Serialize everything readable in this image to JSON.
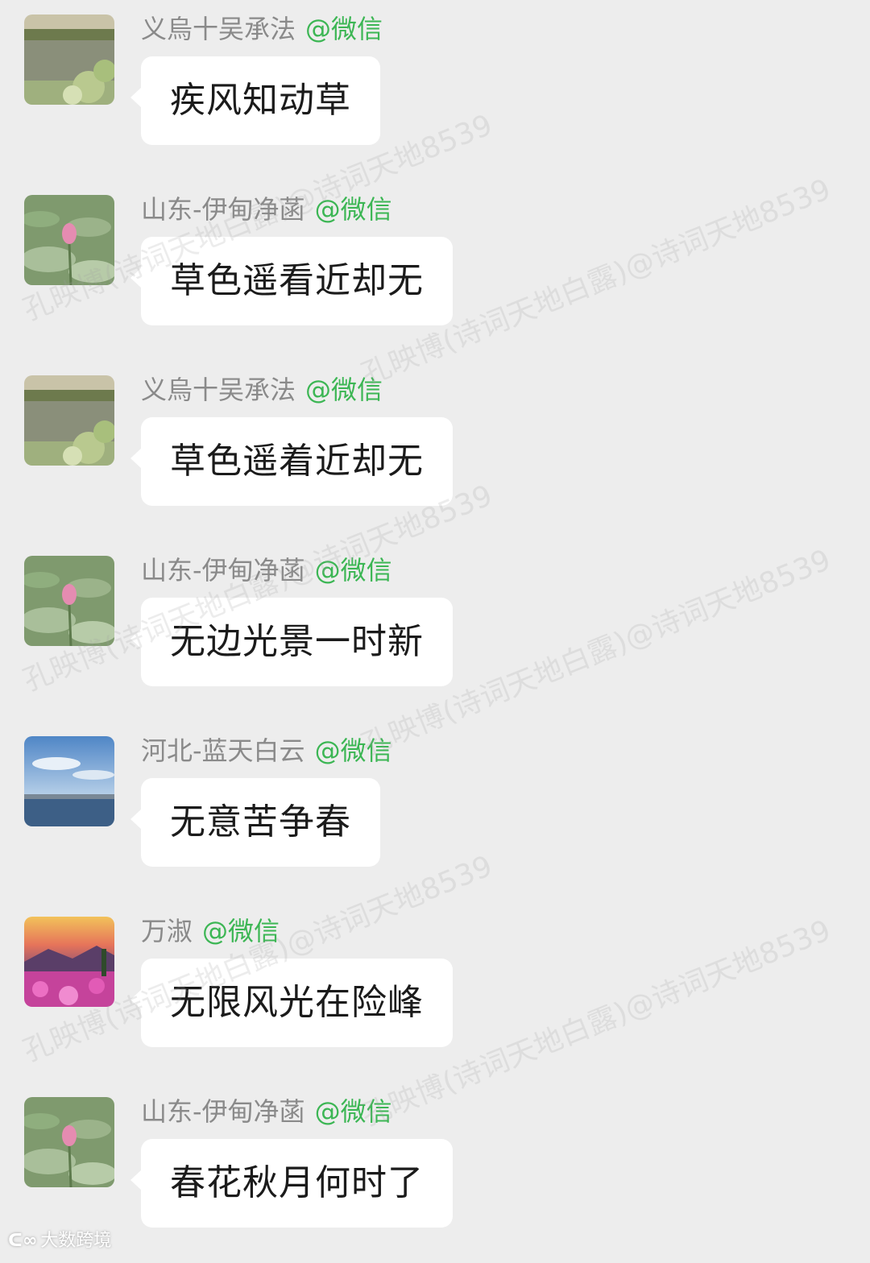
{
  "source_tag": "@微信",
  "messages": [
    {
      "sender": "义烏十吴承法",
      "text": "疾风知动草",
      "avatar": "lake-scene-avatar"
    },
    {
      "sender": "山东-伊甸净菡",
      "text": "草色遥看近却无",
      "avatar": "lotus-avatar"
    },
    {
      "sender": "义烏十吴承法",
      "text": "草色遥着近却无",
      "avatar": "lake-scene-avatar"
    },
    {
      "sender": "山东-伊甸净菡",
      "text": "无边光景一时新",
      "avatar": "lotus-avatar"
    },
    {
      "sender": "河北-蓝天白云",
      "text": "无意苦争春",
      "avatar": "sky-sea-avatar"
    },
    {
      "sender": "万淑",
      "text": "无限风光在险峰",
      "avatar": "sunset-flowers-avatar"
    },
    {
      "sender": "山东-伊甸净菡",
      "text": "春花秋月何时了",
      "avatar": "lotus-avatar"
    }
  ],
  "watermarks": [
    "孔映博(诗词天地白露)@诗词天地8539"
  ],
  "corner_logo": "大数跨境",
  "colors": {
    "background": "#ededed",
    "bubble": "#ffffff",
    "sender_name": "#8a8a8a",
    "source_tag": "#3cb654"
  }
}
